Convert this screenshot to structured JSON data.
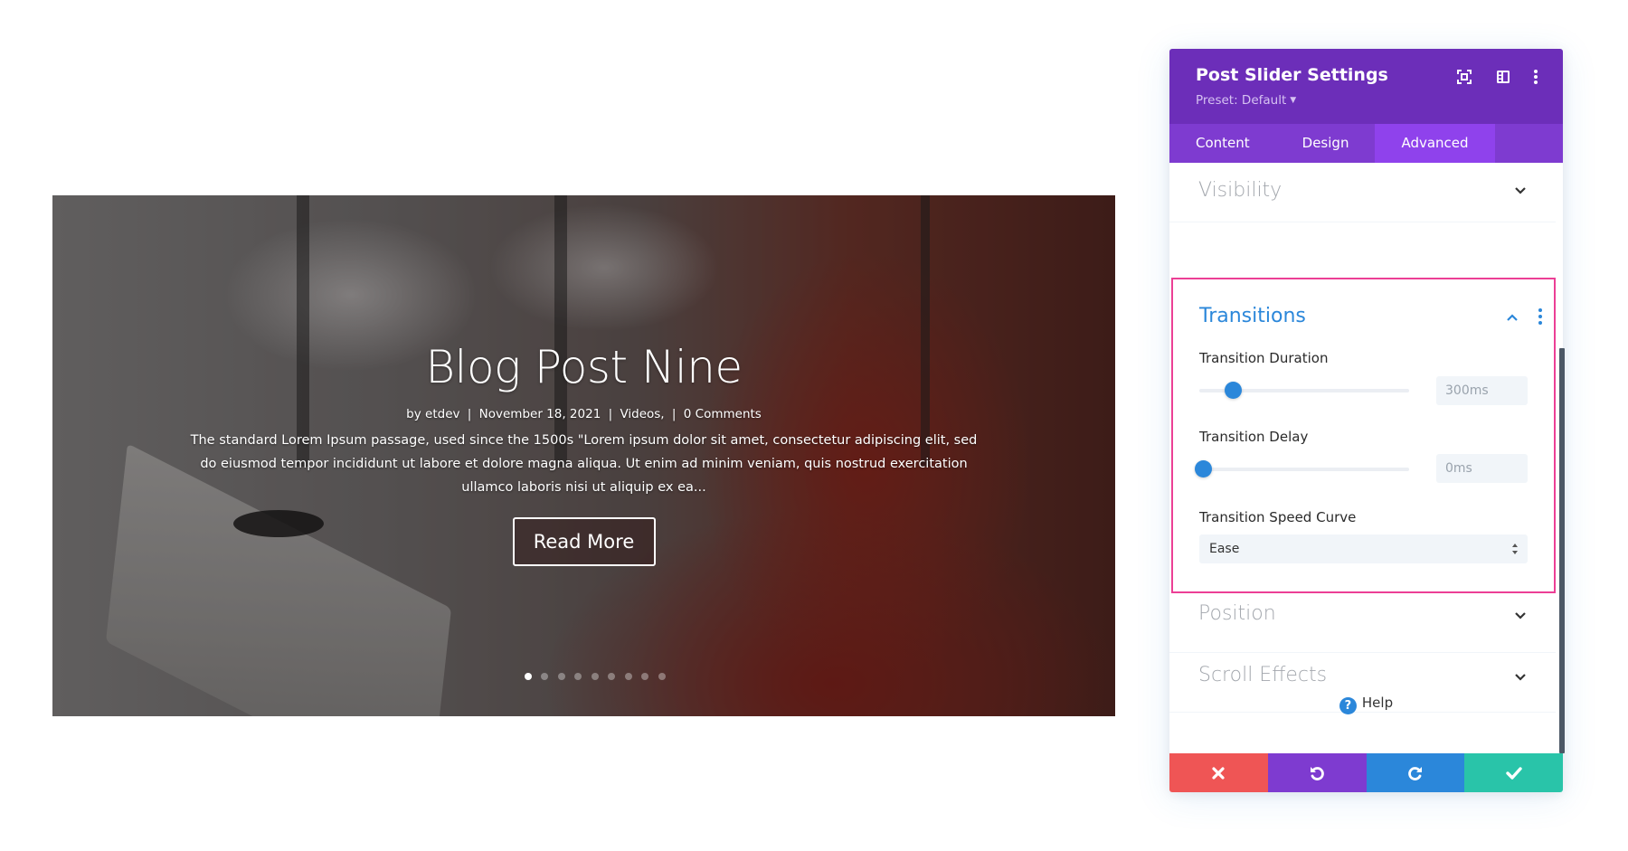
{
  "slider": {
    "title": "Blog Post Nine",
    "meta": {
      "by_prefix": "by",
      "author": "etdev",
      "date": "November 18, 2021",
      "category": "Videos,",
      "comments": "0 Comments",
      "separator": "|"
    },
    "excerpt": "The standard Lorem Ipsum passage, used since the 1500s \"Lorem ipsum dolor sit amet, consectetur adipiscing elit, sed do eiusmod tempor incididunt ut labore et dolore magna aliqua. Ut enim ad minim veniam, quis nostrud exercitation ullamco laboris nisi ut aliquip ex ea...",
    "button_label": "Read More",
    "slide_count": 9,
    "active_slide": 1
  },
  "panel": {
    "title": "Post Slider Settings",
    "preset_label": "Preset: Default",
    "header_icons": [
      "fullscreen-icon",
      "sidebar-layout-icon",
      "more-options-icon"
    ],
    "tabs": [
      {
        "label": "Content",
        "active": false
      },
      {
        "label": "Design",
        "active": false
      },
      {
        "label": "Advanced",
        "active": true
      }
    ],
    "sections": {
      "visibility": "Visibility",
      "transitions": {
        "title": "Transitions",
        "duration": {
          "label": "Transition Duration",
          "value": "300ms",
          "slider_fraction": 0.15
        },
        "delay": {
          "label": "Transition Delay",
          "value": "0ms",
          "slider_fraction": 0.0
        },
        "speed_curve": {
          "label": "Transition Speed Curve",
          "value": "Ease"
        }
      },
      "position": "Position",
      "scroll_effects": "Scroll Effects"
    },
    "help_label": "Help",
    "footer": {
      "cancel_icon": "close-icon",
      "undo_icon": "undo-icon",
      "redo_icon": "redo-icon",
      "save_icon": "check-icon"
    },
    "colors": {
      "header": "#6c2eb9",
      "tabs": "#7e3bd0",
      "tab_active": "#8f42ec",
      "accent_blue": "#2b87da",
      "highlight_border": "#ec3f95",
      "cancel": "#ef5555",
      "undo": "#7e3bd0",
      "redo": "#2b87da",
      "save": "#29c4a9"
    }
  }
}
